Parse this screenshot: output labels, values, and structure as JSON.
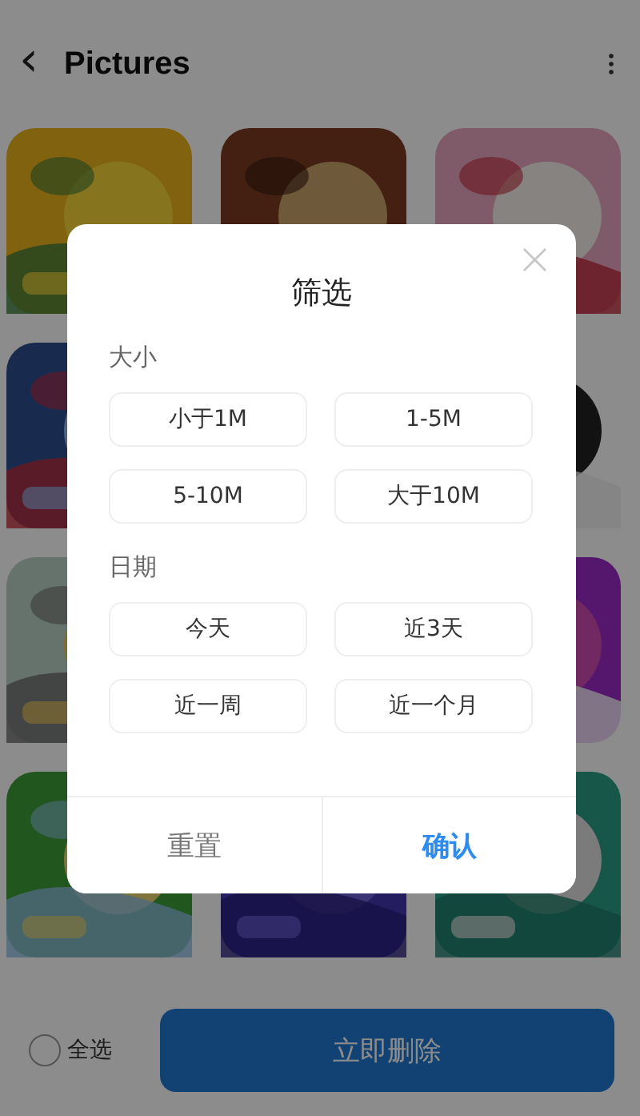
{
  "header": {
    "back_icon": "‹",
    "title": "Pictures"
  },
  "tiles": [
    {
      "kind": "picture"
    },
    {
      "kind": "picture_top"
    },
    {
      "kind": "picture"
    },
    {
      "kind": "picture"
    },
    {
      "kind": "empty"
    },
    {
      "kind": "picture"
    },
    {
      "kind": "picture"
    },
    {
      "kind": "empty"
    },
    {
      "kind": "picture"
    },
    {
      "kind": "picture"
    },
    {
      "kind": "picture"
    },
    {
      "kind": "picture"
    }
  ],
  "bottom_bar": {
    "select_all": {
      "label": "全选",
      "checked": false
    },
    "delete_button": "立即删除"
  },
  "dialog": {
    "title": "筛选",
    "close": "×",
    "sections": [
      {
        "label": "大小",
        "options": [
          {
            "label": "小于1M",
            "selected": false
          },
          {
            "label": "1-5M",
            "selected": false
          },
          {
            "label": "5-10M",
            "selected": false
          },
          {
            "label": "大于10M",
            "selected": false
          }
        ]
      },
      {
        "label": "日期",
        "options": [
          {
            "label": "今天",
            "selected": false
          },
          {
            "label": "近3天",
            "selected": false
          },
          {
            "label": "近一周",
            "selected": false
          },
          {
            "label": "近一个月",
            "selected": false
          }
        ]
      }
    ],
    "buttons": [
      {
        "label": "重置",
        "kind": "secondary"
      },
      {
        "label": "确认",
        "kind": "primary"
      }
    ]
  }
}
